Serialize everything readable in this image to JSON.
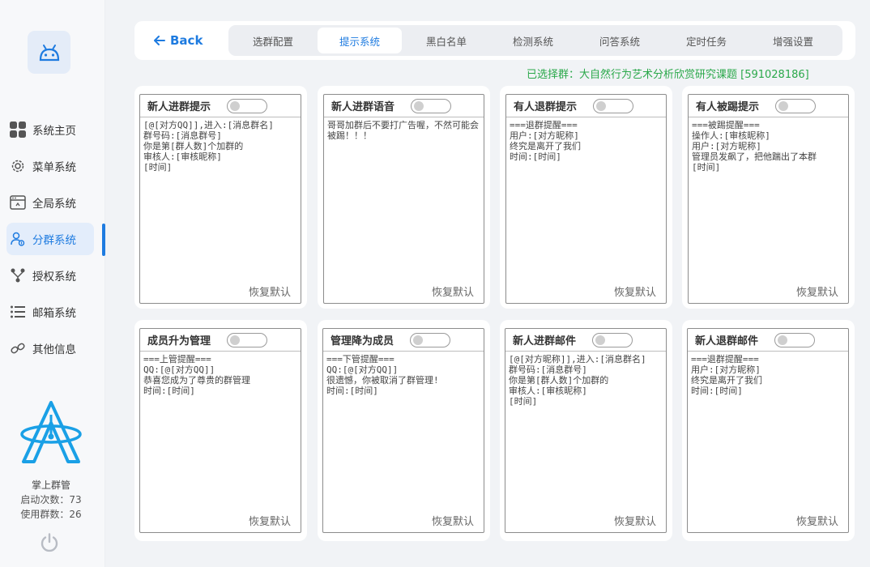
{
  "sidebar": {
    "items": [
      {
        "label": "系统主页",
        "icon": "grid-icon"
      },
      {
        "label": "菜单系统",
        "icon": "gear-icon"
      },
      {
        "label": "全局系统",
        "icon": "window-icon"
      },
      {
        "label": "分群系统",
        "icon": "user-group-icon",
        "active": true
      },
      {
        "label": "授权系统",
        "icon": "branch-icon"
      },
      {
        "label": "邮箱系统",
        "icon": "list-icon"
      },
      {
        "label": "其他信息",
        "icon": "link-icon"
      }
    ],
    "brand_name": "掌上群管",
    "launch_count": "启动次数：73",
    "group_count": "使用群数：26"
  },
  "header": {
    "back_label": "Back",
    "tabs": [
      {
        "label": "选群配置"
      },
      {
        "label": "提示系统",
        "active": true
      },
      {
        "label": "黑白名单"
      },
      {
        "label": "检测系统"
      },
      {
        "label": "问答系统"
      },
      {
        "label": "定时任务"
      },
      {
        "label": "增强设置"
      }
    ]
  },
  "selected_group": "已选择群：大自然行为艺术分析欣赏研究课题 [591028186]",
  "cards": [
    {
      "title": "新人进群提示",
      "content": "[@[对方QQ]],进入:[消息群名]\n群号码:[消息群号]\n你是第[群人数]个加群的\n审核人:[审核昵称]\n[时间]",
      "reset": "恢复默认"
    },
    {
      "title": "新人进群语音",
      "content": "哥哥加群后不要打广告喔，不然可能会被踢！！！",
      "reset": "恢复默认"
    },
    {
      "title": "有人退群提示",
      "content": "===退群提醒===\n用户:[对方昵称]\n终究是离开了我们\n时间:[时间]",
      "reset": "恢复默认"
    },
    {
      "title": "有人被踢提示",
      "content": "===被踢提醒===\n操作人:[审核昵称]\n用户:[对方昵称]\n管理员发飙了，把他踹出了本群\n[时间]",
      "reset": "恢复默认"
    },
    {
      "title": "成员升为管理",
      "content": "===上管提醒===\nQQ:[@[对方QQ]]\n恭喜您成为了尊贵的群管理\n时间:[时间]",
      "reset": "恢复默认"
    },
    {
      "title": "管理降为成员",
      "content": "===下管提醒===\nQQ:[@[对方QQ]]\n很遗憾，你被取消了群管理!\n时间:[时间]",
      "reset": "恢复默认"
    },
    {
      "title": "新人进群邮件",
      "content": "[@[对方昵称]],进入:[消息群名]\n群号码:[消息群号]\n你是第[群人数]个加群的\n审核人:[审核昵称]\n[时间]",
      "reset": "恢复默认"
    },
    {
      "title": "新人退群邮件",
      "content": "===退群提醒===\n用户:[对方昵称]\n终究是离开了我们\n时间:[时间]",
      "reset": "恢复默认"
    }
  ],
  "colors": {
    "accent": "#1e7be0",
    "success": "#2aa84a",
    "logo": "#1aa0e6"
  }
}
